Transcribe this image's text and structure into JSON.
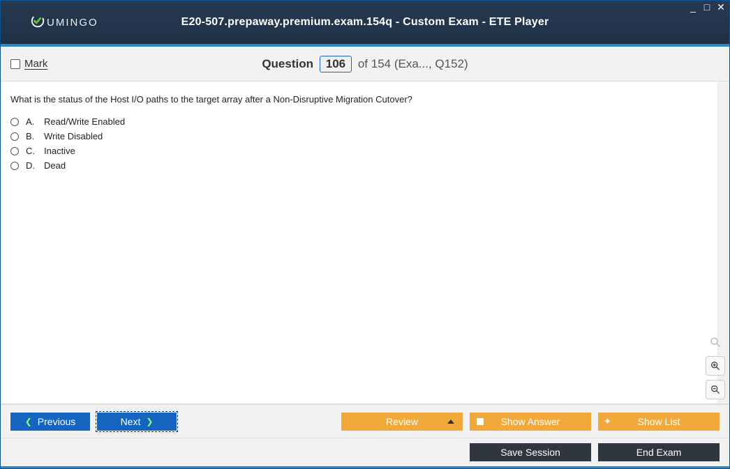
{
  "window": {
    "title": "E20-507.prepaway.premium.exam.154q - Custom Exam - ETE Player",
    "logo_text": "UMINGO"
  },
  "qbar": {
    "mark_label": "Mark",
    "question_word": "Question",
    "current": "106",
    "total": "of 154",
    "meta": "(Exa..., Q152)"
  },
  "question": {
    "text": "What is the status of the Host I/O paths to the target array after a Non-Disruptive Migration Cutover?",
    "choices": [
      {
        "letter": "A.",
        "text": "Read/Write Enabled"
      },
      {
        "letter": "B.",
        "text": "Write Disabled"
      },
      {
        "letter": "C.",
        "text": "Inactive"
      },
      {
        "letter": "D.",
        "text": "Dead"
      }
    ]
  },
  "footer": {
    "previous": "Previous",
    "next": "Next",
    "review": "Review",
    "show_answer": "Show Answer",
    "show_list": "Show List",
    "save_session": "Save Session",
    "end_exam": "End Exam"
  }
}
